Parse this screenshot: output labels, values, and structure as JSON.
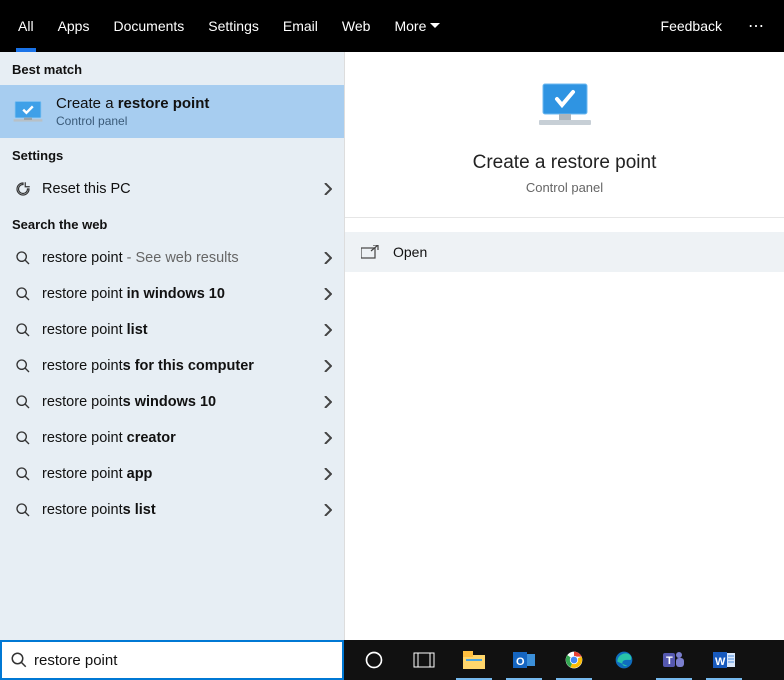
{
  "topbar": {
    "tabs": [
      "All",
      "Apps",
      "Documents",
      "Settings",
      "Email",
      "Web",
      "More"
    ],
    "active": 0,
    "feedback": "Feedback"
  },
  "left": {
    "best_match_h": "Best match",
    "best_match": {
      "title_plain": "Create a ",
      "title_bold": "restore point",
      "subtitle": "Control panel"
    },
    "settings_h": "Settings",
    "settings": [
      {
        "label": "Reset this PC"
      }
    ],
    "web_h": "Search the web",
    "web": [
      {
        "plain": "restore point",
        "bold": "",
        "suffix_grey": " - See web results"
      },
      {
        "plain": "restore point ",
        "bold": "in windows 10"
      },
      {
        "plain": "restore point ",
        "bold": "list"
      },
      {
        "plain": "restore point",
        "bold": "s for this computer"
      },
      {
        "plain": "restore point",
        "bold": "s windows 10"
      },
      {
        "plain": "restore point ",
        "bold": "creator"
      },
      {
        "plain": "restore point ",
        "bold": "app"
      },
      {
        "plain": "restore point",
        "bold": "s list"
      }
    ]
  },
  "right": {
    "title": "Create a restore point",
    "subtitle": "Control panel",
    "open": "Open"
  },
  "search": {
    "value": "restore point"
  }
}
